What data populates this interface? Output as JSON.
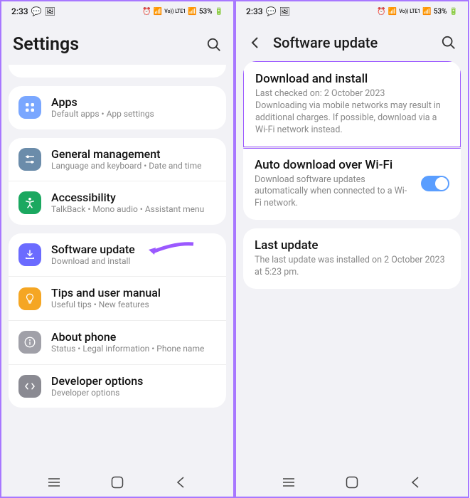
{
  "status": {
    "time": "2:33",
    "battery": "53%",
    "net": "Vo)) LTE1"
  },
  "left": {
    "title": "Settings",
    "groups": [
      {
        "items": [
          {
            "icon": "apps",
            "color": "#7aa7ff",
            "title": "Apps",
            "sub": "Default apps • App settings"
          }
        ]
      },
      {
        "items": [
          {
            "icon": "sliders",
            "color": "#6b8caa",
            "title": "General management",
            "sub": "Language and keyboard • Date and time"
          },
          {
            "icon": "accessibility",
            "color": "#1ba860",
            "title": "Accessibility",
            "sub": "TalkBack • Mono audio • Assistant menu"
          }
        ]
      },
      {
        "items": [
          {
            "icon": "update",
            "color": "#6b6bff",
            "title": "Software update",
            "sub": "Download and install"
          },
          {
            "icon": "tips",
            "color": "#f5a623",
            "title": "Tips and user manual",
            "sub": "Useful tips • New features"
          },
          {
            "icon": "info",
            "color": "#a0a0a8",
            "title": "About phone",
            "sub": "Status • Legal information • Phone name"
          },
          {
            "icon": "dev",
            "color": "#8a8a92",
            "title": "Developer options",
            "sub": "Developer options"
          }
        ]
      }
    ]
  },
  "right": {
    "title": "Software update",
    "groups": [
      {
        "items": [
          {
            "title": "Download and install",
            "desc": "Last checked on: 2 October 2023\nDownloading via mobile networks may result in additional charges. If possible, download via a Wi-Fi network instead.",
            "highlight": true
          },
          {
            "title": "Auto download over Wi-Fi",
            "desc": "Download software updates automatically when connected to a Wi-Fi network.",
            "toggle": true
          }
        ]
      },
      {
        "items": [
          {
            "title": "Last update",
            "desc": "The last update was installed on 2 October 2023 at 5:23 pm."
          }
        ]
      }
    ]
  }
}
